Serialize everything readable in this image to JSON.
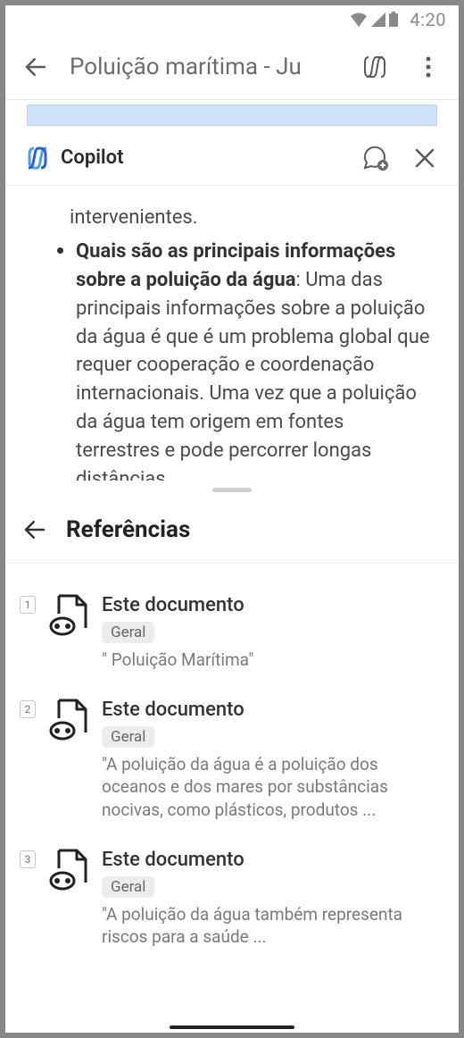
{
  "status_bar": {
    "time": "4:20"
  },
  "app_bar": {
    "title": "Poluição marítima - Ju"
  },
  "copilot_header": {
    "title": "Copilot"
  },
  "chat": {
    "prev_tail": "intervenientes.",
    "bullet_bold": "Quais são as principais informações sobre a poluição da água",
    "bullet_rest": ": Uma das principais informações sobre a poluição da água é que é um problema global que requer cooperação e coordenação internacionais. Uma vez que a poluição da água tem origem em fontes terrestres e pode percorrer longas distâncias"
  },
  "references": {
    "title": "Referências",
    "items": [
      {
        "index": "1",
        "title": "Este documento",
        "badge": "Geral",
        "quote": "\" Poluição Marítima\""
      },
      {
        "index": "2",
        "title": "Este documento",
        "badge": "Geral",
        "quote": "\"A poluição da água é a poluição dos oceanos e dos mares por substâncias nocivas, como plásticos, produtos ..."
      },
      {
        "index": "3",
        "title": "Este documento",
        "badge": "Geral",
        "quote": "\"A poluição da água também representa riscos para a saúde ..."
      }
    ]
  }
}
